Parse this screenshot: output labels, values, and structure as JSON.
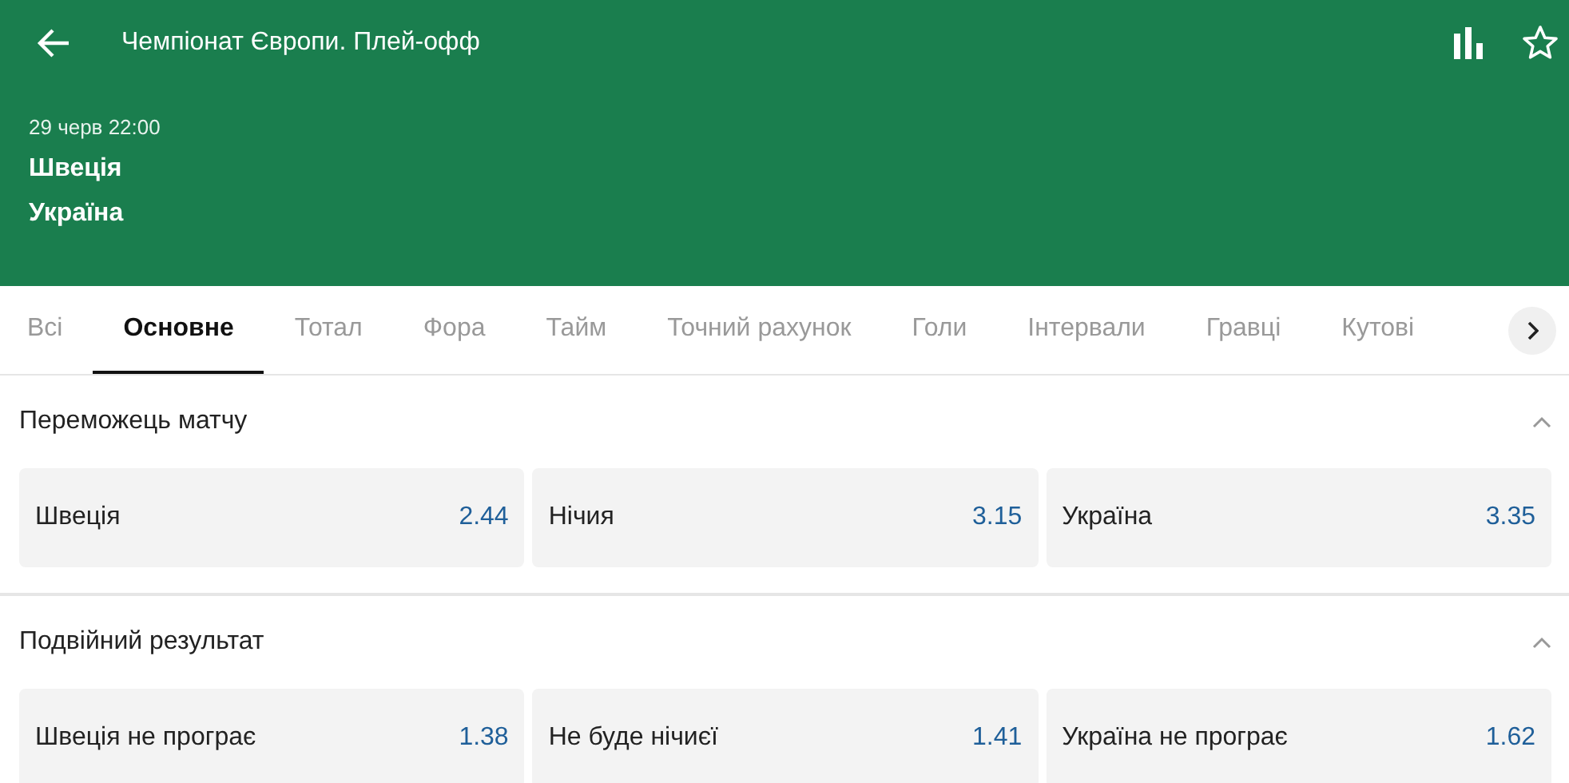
{
  "header": {
    "title": "Чемпіонат Європи. Плей-офф",
    "date": "29 черв 22:00",
    "teams": [
      "Швеція",
      "Україна"
    ],
    "favorite": false
  },
  "tabs": [
    {
      "label": "Всі",
      "selected": false
    },
    {
      "label": "Основне",
      "selected": true
    },
    {
      "label": "Тотал",
      "selected": false
    },
    {
      "label": "Фора",
      "selected": false
    },
    {
      "label": "Тайм",
      "selected": false
    },
    {
      "label": "Точний рахунок",
      "selected": false
    },
    {
      "label": "Голи",
      "selected": false
    },
    {
      "label": "Інтервали",
      "selected": false
    },
    {
      "label": "Гравці",
      "selected": false
    },
    {
      "label": "Кутові",
      "selected": false
    }
  ],
  "markets": [
    {
      "title": "Переможець матчу",
      "expanded": true,
      "outcomes": [
        {
          "label": "Швеція",
          "odds": "2.44"
        },
        {
          "label": "Нічия",
          "odds": "3.15"
        },
        {
          "label": "Україна",
          "odds": "3.35"
        }
      ]
    },
    {
      "title": "Подвійний результат",
      "expanded": true,
      "outcomes": [
        {
          "label": "Швеція не програє",
          "odds": "1.38"
        },
        {
          "label": "Не буде нічиєї",
          "odds": "1.41"
        },
        {
          "label": "Україна не програє",
          "odds": "1.62"
        }
      ]
    }
  ]
}
